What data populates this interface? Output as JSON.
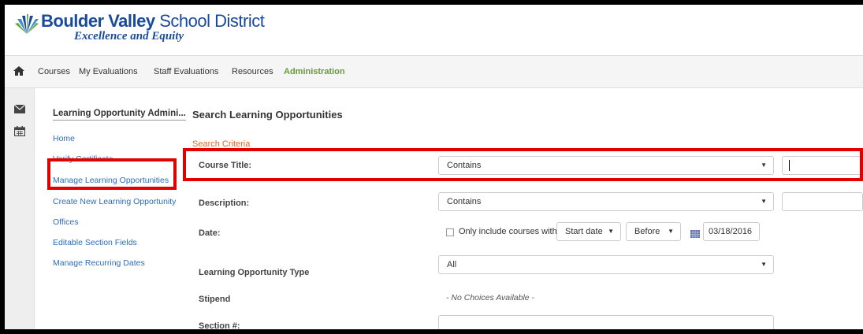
{
  "header": {
    "logo_bold": "Boulder Valley",
    "logo_rest": " School District",
    "tagline": "Excellence and Equity"
  },
  "nav": {
    "items": [
      "Courses",
      "My Evaluations",
      "Staff Evaluations",
      "Resources",
      "Administration"
    ],
    "active": "Administration"
  },
  "rail": {
    "icons": [
      "envelope-icon",
      "calendar-icon"
    ]
  },
  "sidebar": {
    "title": "Learning Opportunity Admini...",
    "links": [
      "Home",
      "Verify Certificate",
      "Manage Learning Opportunities",
      "Create New Learning Opportunity",
      "Offices",
      "Editable Section Fields",
      "Manage Recurring Dates"
    ]
  },
  "main": {
    "title": "Search Learning Opportunities",
    "criteria_label": "Search Criteria",
    "course_title": {
      "label": "Course Title:",
      "operator": "Contains",
      "value": ""
    },
    "description": {
      "label": "Description:",
      "operator": "Contains",
      "value": ""
    },
    "date": {
      "label": "Date:",
      "checkbox_label": "Only include courses with",
      "field": "Start date",
      "comparison": "Before",
      "value": "03/18/2016"
    },
    "type": {
      "label": "Learning Opportunity Type",
      "value": "All"
    },
    "stipend": {
      "label": "Stipend",
      "value": "- No Choices Available -"
    },
    "section": {
      "label": "Section #:",
      "value": ""
    }
  },
  "colors": {
    "brand_blue": "#1a4b9b",
    "link_blue": "#2a6ebb",
    "active_green": "#6a9a3a",
    "criteria_orange": "#e0662a",
    "highlight_red": "#e00000"
  }
}
